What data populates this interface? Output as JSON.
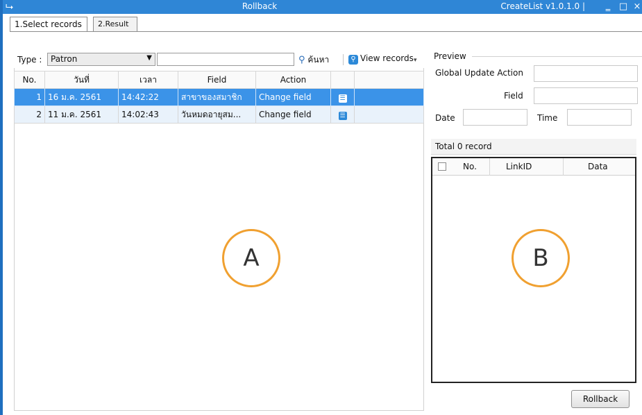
{
  "window": {
    "title": "Rollback",
    "version": "CreateList v1.0.1.0 |",
    "controls": {
      "minimize": "‗",
      "maximize": "□",
      "close": "×"
    }
  },
  "tabs": [
    {
      "label": "1.Select records",
      "active": true
    },
    {
      "label": "2.Result",
      "active": false
    }
  ],
  "toolbar": {
    "type_label": "Type :",
    "type_value": "Patron",
    "search_value": "",
    "search_label": "ค้นหา",
    "view_label": "View records",
    "overflow_glyph": "▾"
  },
  "grid": {
    "columns": [
      "No.",
      "วันที่",
      "เวลา",
      "Field",
      "Action",
      "",
      ""
    ],
    "rows": [
      {
        "no": "1",
        "date": "16 ม.ค. 2561",
        "time": "14:42:22",
        "field": "สาขาของสมาชิก",
        "action": "Change field",
        "icon": "list-icon",
        "selected": true
      },
      {
        "no": "2",
        "date": "11 ม.ค. 2561",
        "time": "14:02:43",
        "field": "วันหมดอายุสม...",
        "action": "Change field",
        "icon": "list-icon",
        "selected": false
      }
    ]
  },
  "markers": {
    "a": "A",
    "b": "B"
  },
  "preview": {
    "legend": "Preview",
    "global_update_action_label": "Global Update Action",
    "field_label": "Field",
    "date_label": "Date",
    "time_label": "Time",
    "global_update_action_value": "",
    "field_value": "",
    "date_value": "",
    "time_value": ""
  },
  "result_table": {
    "total_text": "Total 0 record",
    "columns": [
      "No.",
      "LinkID",
      "Data"
    ]
  },
  "rollback_label": "Rollback",
  "colors": {
    "titlebar": "#2f86d6",
    "selected_row": "#3b93e8",
    "marker": "#f0a030"
  }
}
